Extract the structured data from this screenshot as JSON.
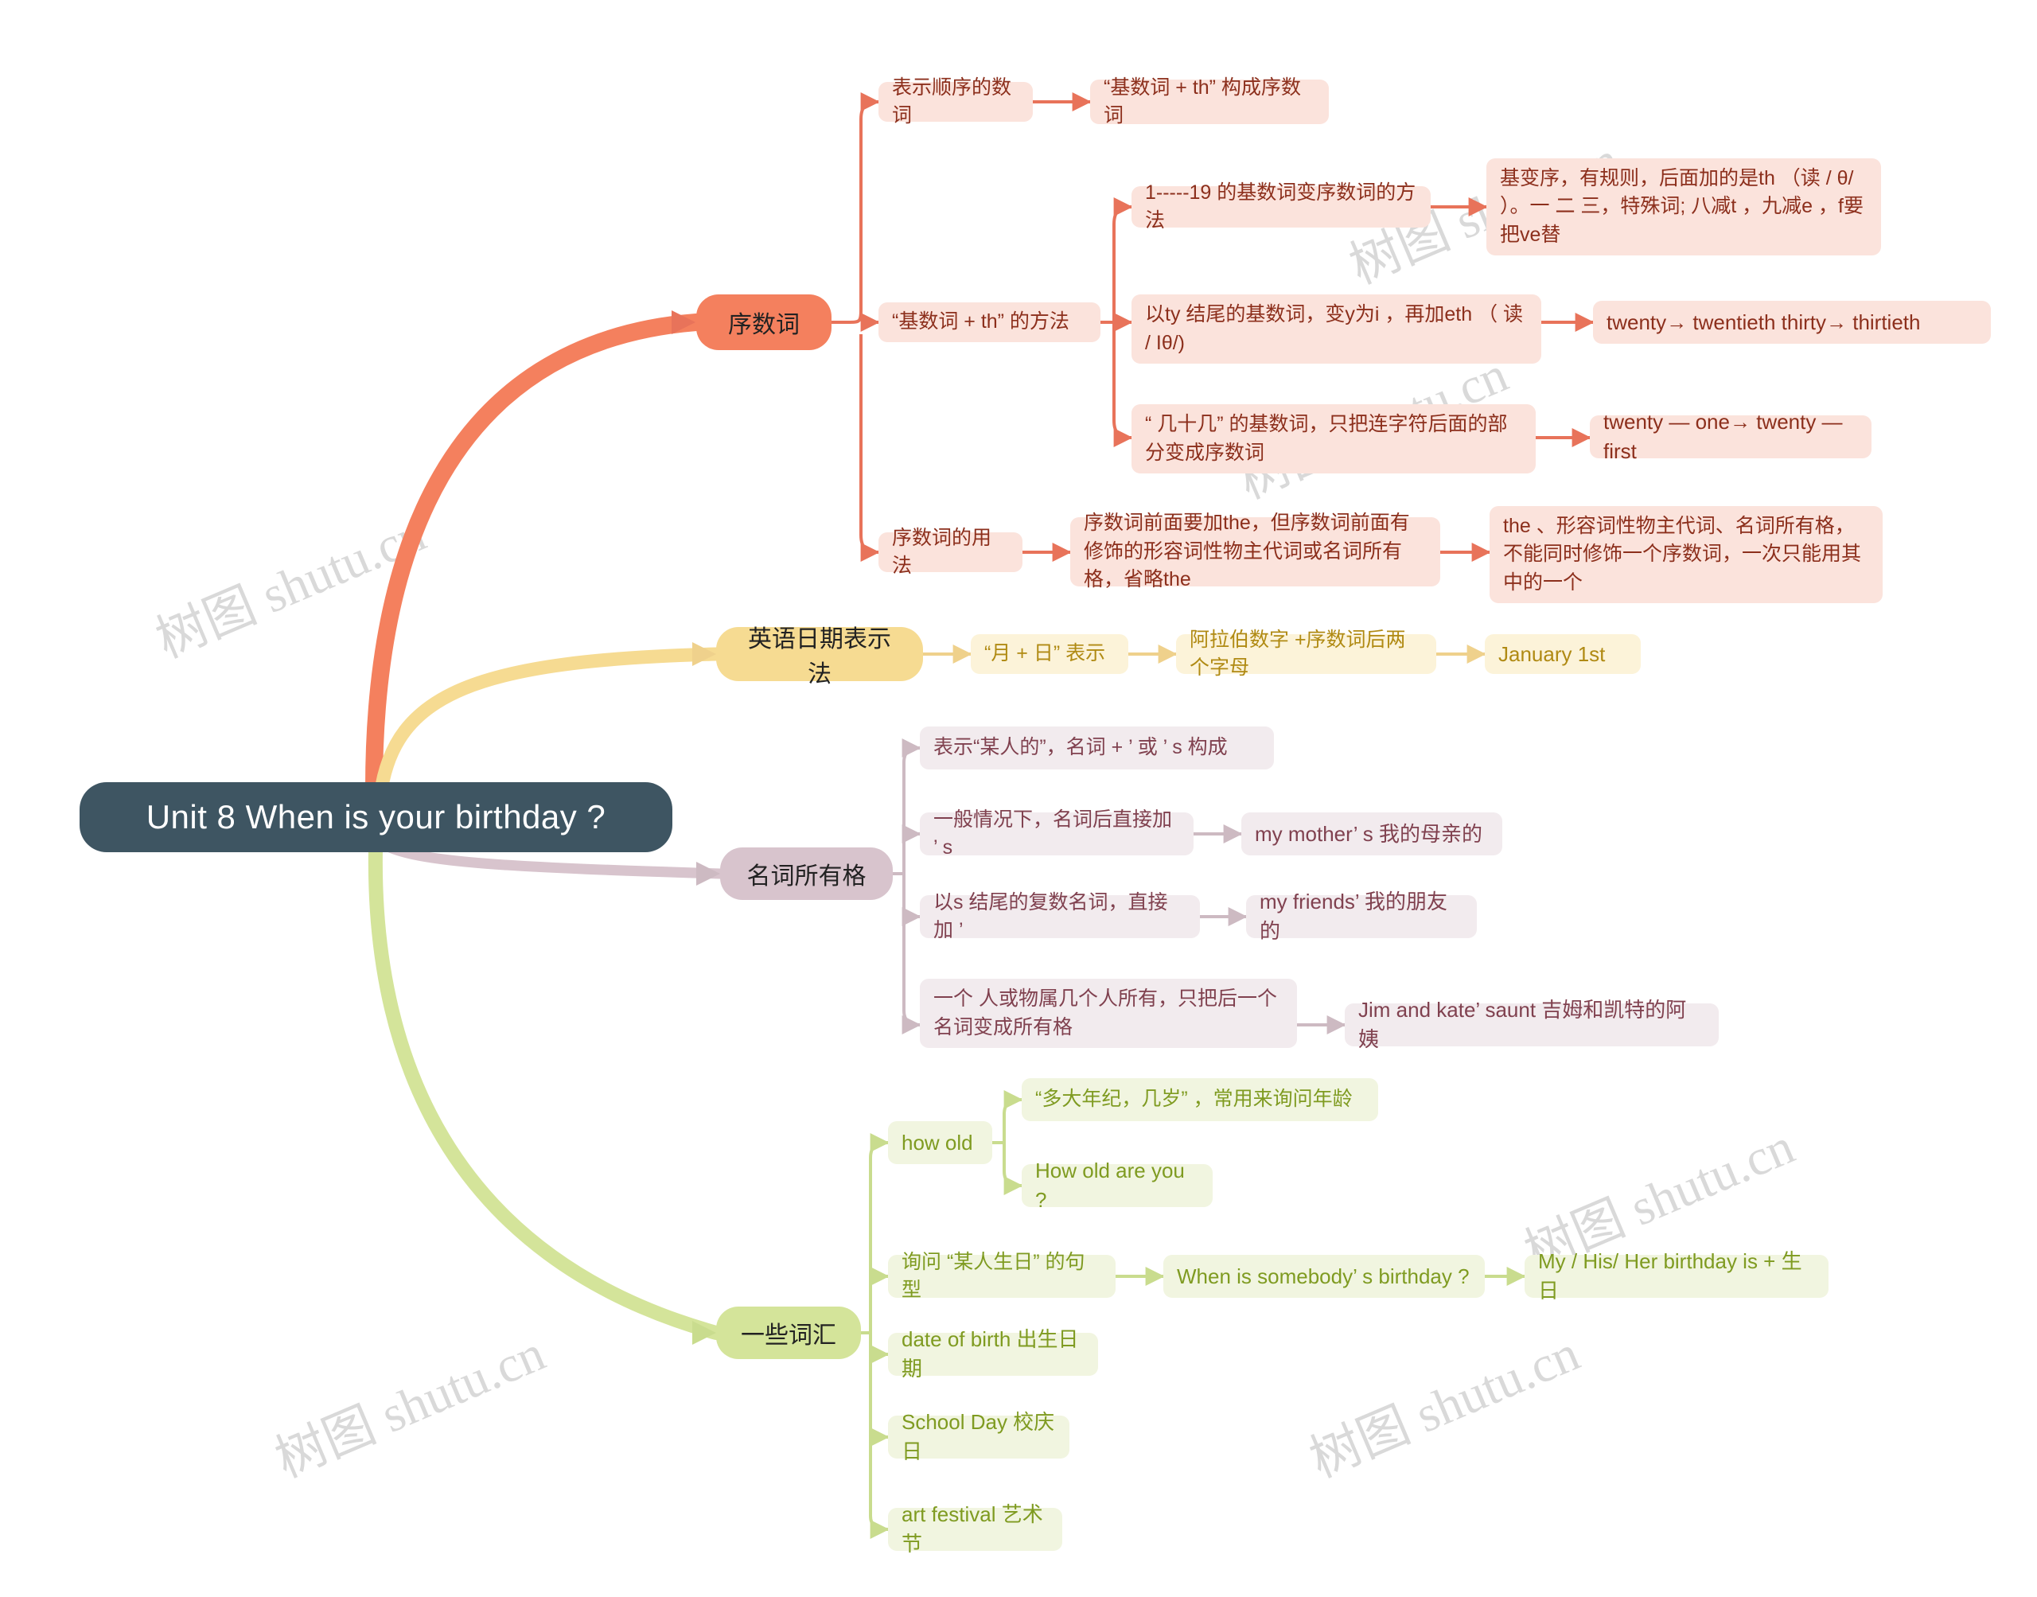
{
  "meta": {
    "title": "Unit 8 When is your birthday ?",
    "watermark_text": "树图 shutu.cn",
    "colors": {
      "root_bg": "#3E5562",
      "orange": "#F4805E",
      "yellow": "#F6DB92",
      "purple": "#D8C4CD",
      "green": "#D4E49A",
      "leaf_orange_bg": "#FBE3DC",
      "leaf_orange_fg": "#8C2F1C",
      "leaf_yellow_bg": "#FCF3D9",
      "leaf_yellow_fg": "#B08A13",
      "leaf_purple_bg": "#F2EBEE",
      "leaf_purple_fg": "#80414F",
      "leaf_green_bg": "#F1F5E0",
      "leaf_green_fg": "#7F9B21"
    }
  },
  "root": {
    "label": "Unit 8 When is your birthday ?"
  },
  "branches": {
    "ordinal": {
      "label": "序数词",
      "children": {
        "meaning": "表示顺序的数词",
        "meaning_detail": "“基数词 + th” 构成序数词",
        "method": "“基数词 + th” 的方法",
        "method_1_19": "1-----19 的基数词变序数词的方法",
        "method_1_19_detail": "基变序，有规则，后面加的是th （读 / θ/ ）。一 二 三，特殊词; 八减t ，九减e ，f要把ve替",
        "method_ty": "以ty 结尾的基数词，变y为i ，再加eth （ 读 / Iθ/)",
        "method_ty_example": "twenty→ twentieth thirty→ thirtieth",
        "method_compound": "“ 几十几” 的基数词，只把连字符后面的部分变成序数词",
        "method_compound_example": "twenty — one→ twenty — first",
        "usage": "序数词的用法",
        "usage_detail": "序数词前面要加the，但序数词前面有修饰的形容词性物主代词或名词所有格，省略the",
        "usage_detail2": "the 、形容词性物主代词、名词所有格，不能同时修饰一个序数词，一次只能用其中的一个"
      }
    },
    "date": {
      "label": "英语日期表示法",
      "children": {
        "form": "“月 + 日” 表示",
        "form_detail": "阿拉伯数字 +序数词后两个字母",
        "example": "January 1st"
      }
    },
    "possessive": {
      "label": "名词所有格",
      "children": {
        "definition": "表示“某人的”，名词 + ’ 或 ’ s 构成",
        "rule_general": "一般情况下，名词后直接加 ’ s",
        "rule_general_example": "my mother’ s 我的母亲的",
        "rule_plural_s": "以s 结尾的复数名词，直接加 ’",
        "rule_plural_s_example": "my friends’ 我的朋友的",
        "rule_joint": "一个 人或物属几个人所有，只把后一个名词变成所有格",
        "rule_joint_example": "Jim and kate’ saunt 吉姆和凯特的阿姨"
      }
    },
    "vocabulary": {
      "label": "一些词汇",
      "children": {
        "how_old": "how old",
        "how_old_meaning": "“多大年纪，几岁” ，常用来询问年龄",
        "how_old_example": "How old are you ?",
        "ask_birthday": "询问 “某人生日” 的句型",
        "ask_birthday_question": "When is somebody’ s birthday ?",
        "ask_birthday_answer": "My / His/ Her birthday is + 生日",
        "date_of_birth": "date of birth 出生日期",
        "school_day": "School Day 校庆日",
        "art_festival": "art festival 艺术节"
      }
    }
  }
}
